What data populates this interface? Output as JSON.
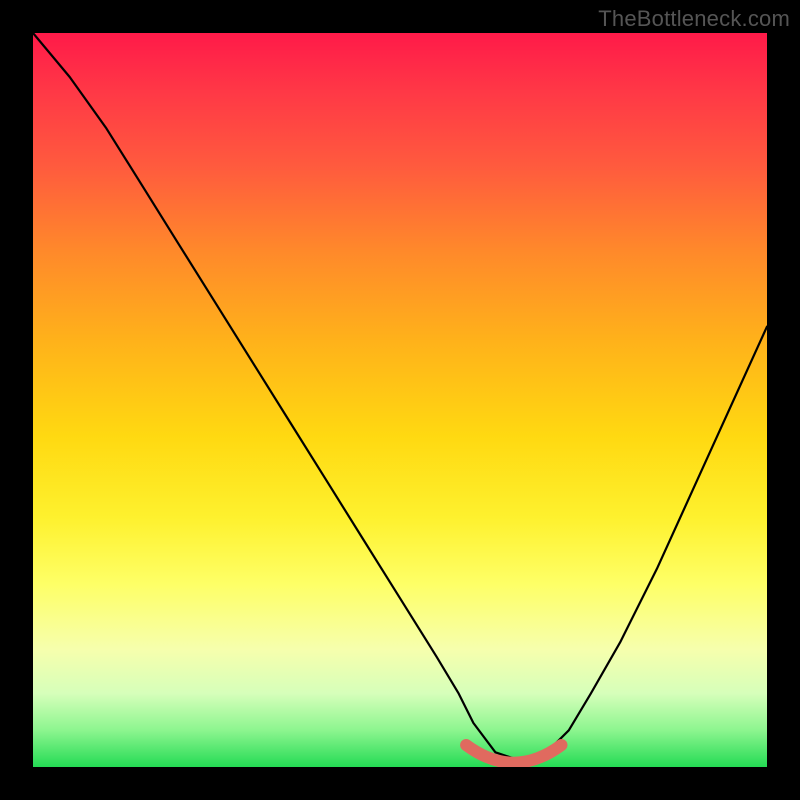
{
  "watermark": "TheBottleneck.com",
  "colors": {
    "background": "#000000",
    "gradient_top": "#ff1a49",
    "gradient_mid": "#ffd911",
    "gradient_bottom": "#24db54",
    "curve": "#000000",
    "marker": "#e06a5f"
  },
  "chart_data": {
    "type": "line",
    "title": "",
    "xlabel": "",
    "ylabel": "",
    "xlim": [
      0,
      100
    ],
    "ylim": [
      0,
      100
    ],
    "note": "Axes are unlabeled; values are normalized 0-100. Curve is a V-shape with a flat minimum near x≈63-70. Y=100 at top (red), Y=0 at bottom (green).",
    "series": [
      {
        "name": "curve",
        "x": [
          0,
          5,
          10,
          15,
          20,
          25,
          30,
          35,
          40,
          45,
          50,
          55,
          58,
          60,
          63,
          66,
          70,
          73,
          76,
          80,
          85,
          90,
          95,
          100
        ],
        "y": [
          100,
          94,
          87,
          79,
          71,
          63,
          55,
          47,
          39,
          31,
          23,
          15,
          10,
          6,
          2,
          1,
          2,
          5,
          10,
          17,
          27,
          38,
          49,
          60
        ]
      }
    ],
    "marker": {
      "name": "flat-minimum",
      "x_range": [
        59,
        72
      ],
      "y": 1
    }
  }
}
